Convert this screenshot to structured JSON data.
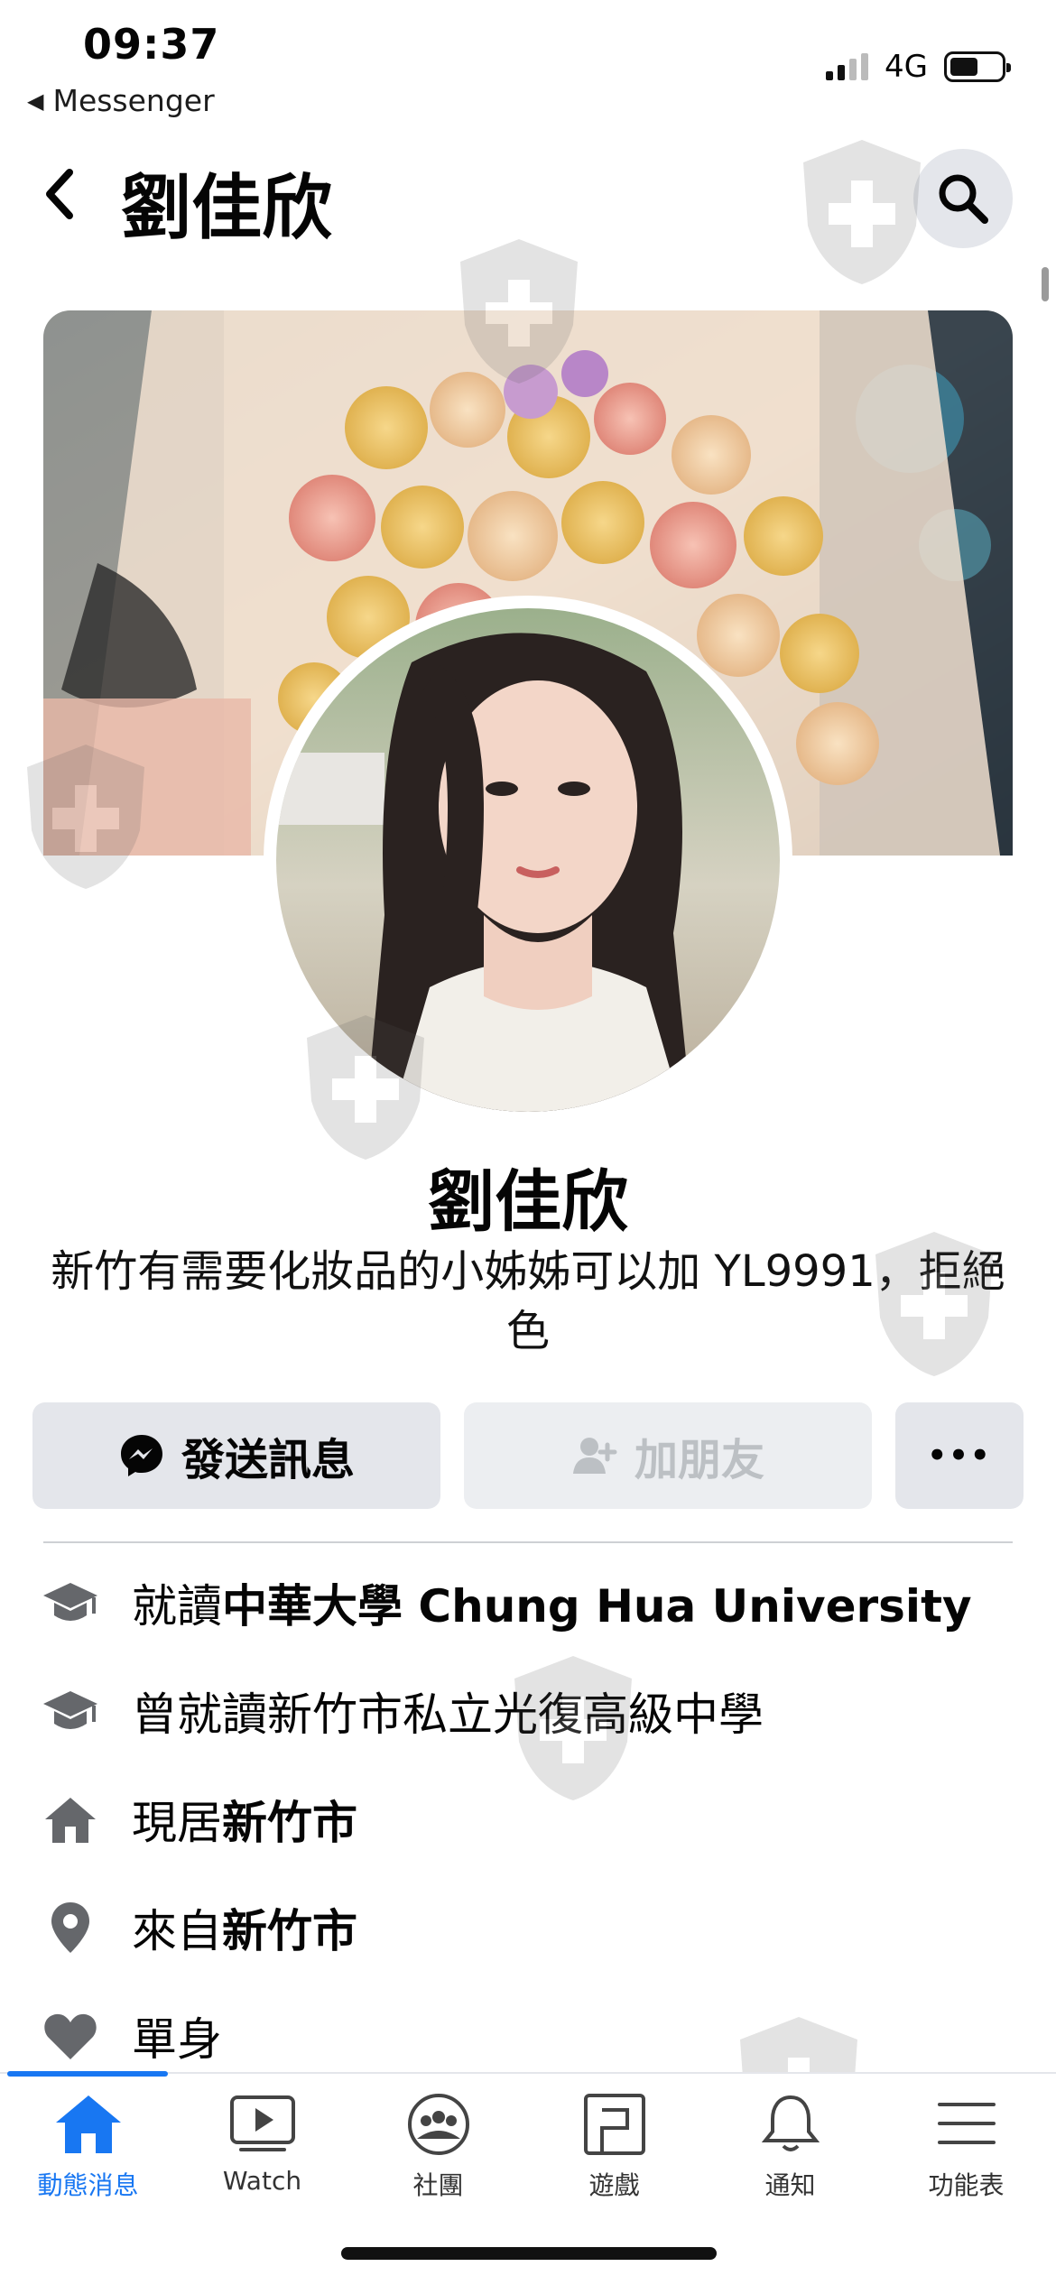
{
  "status_bar": {
    "time": "09:37",
    "back_app": "Messenger",
    "network": "4G",
    "battery_level": 0.55
  },
  "header": {
    "title": "劉佳欣"
  },
  "profile": {
    "name": "劉佳欣",
    "bio": "新竹有需要化妝品的小姊姊可以加 YL9991，拒絕色"
  },
  "actions": {
    "message_label": "發送訊息",
    "add_friend_label": "加朋友",
    "more_label": "•••"
  },
  "info": [
    {
      "icon": "graduation-cap-icon",
      "prefix": "就讀",
      "highlight": "中華大學 Chung Hua University"
    },
    {
      "icon": "graduation-cap-icon",
      "prefix": "曾就讀新竹市私立光復高級中學",
      "highlight": ""
    },
    {
      "icon": "home-icon",
      "prefix": "現居",
      "highlight": "新竹市"
    },
    {
      "icon": "location-pin-icon",
      "prefix": "來自",
      "highlight": "新竹市"
    },
    {
      "icon": "heart-icon",
      "prefix": "單身",
      "highlight": ""
    }
  ],
  "tabs": [
    {
      "label": "動態消息",
      "icon": "home-icon",
      "active": true
    },
    {
      "label": "Watch",
      "icon": "watch-video-icon",
      "active": false
    },
    {
      "label": "社團",
      "icon": "groups-icon",
      "active": false
    },
    {
      "label": "遊戲",
      "icon": "gaming-icon",
      "active": false
    },
    {
      "label": "通知",
      "icon": "bell-icon",
      "active": false
    },
    {
      "label": "功能表",
      "icon": "menu-icon",
      "active": false
    }
  ],
  "colors": {
    "accent": "#1877f2",
    "button_bg": "#e4e6eb",
    "text": "#050505",
    "icon_gray": "#65676b"
  }
}
